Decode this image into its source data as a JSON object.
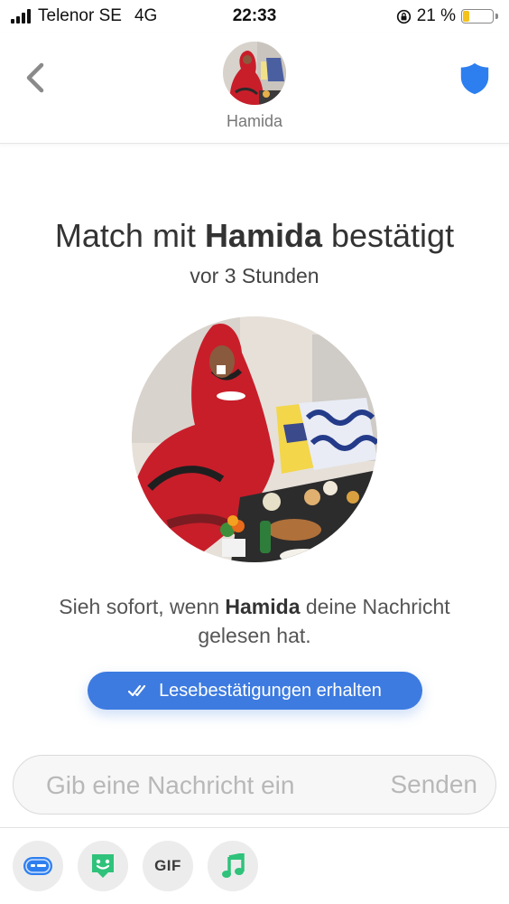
{
  "status_bar": {
    "carrier": "Telenor SE",
    "network": "4G",
    "time": "22:33",
    "battery_percent": "21 %",
    "battery_level": 0.21
  },
  "header": {
    "back_icon": "chevron-left-icon",
    "profile_name": "Hamida",
    "safety_icon": "shield-icon",
    "accent_color": "#2d7ff0"
  },
  "match": {
    "title_prefix": "Match mit ",
    "name": "Hamida",
    "title_suffix": " bestätigt",
    "time_ago": "vor 3 Stunden"
  },
  "read_receipts": {
    "text_prefix": "Sieh sofort, wenn ",
    "name": "Hamida",
    "text_suffix": " deine Nachricht gelesen hat.",
    "button_label": "Lesebestätigungen erhalten",
    "button_color": "#3d7be0"
  },
  "composer": {
    "placeholder": "Gib eine Nachricht ein",
    "send_label": "Senden"
  },
  "toolbar": {
    "items": [
      {
        "icon": "message-card-icon",
        "color": "#2d7ff0"
      },
      {
        "icon": "sticker-icon",
        "color": "#2fc27a"
      },
      {
        "icon": "gif-icon",
        "label": "GIF"
      },
      {
        "icon": "music-note-icon",
        "color": "#2fc27a"
      }
    ]
  }
}
